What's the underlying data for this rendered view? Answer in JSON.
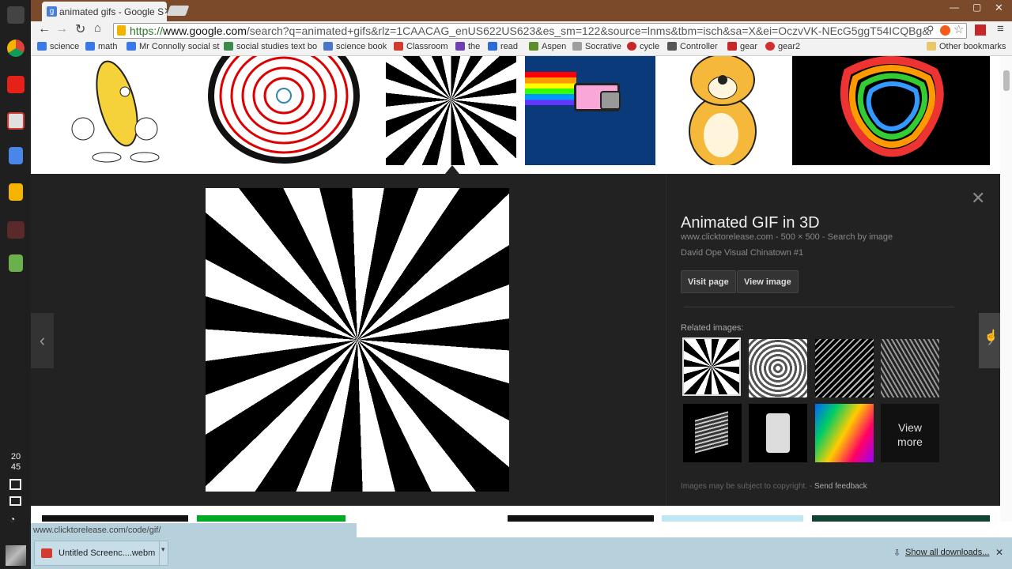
{
  "tab": {
    "title": "animated gifs - Google S"
  },
  "omnibox": {
    "url_scheme": "https://",
    "url_host": "www.google.com",
    "url_rest": "/search?q=animated+gifs&rlz=1CAACAG_enUS622US623&es_sm=122&source=lnms&tbm=isch&sa=X&ei=OczvVK-NEcG5ggT54ICQBg&"
  },
  "bookmarks": [
    {
      "label": "science",
      "color": "#3b78e7"
    },
    {
      "label": "math",
      "color": "#3b78e7"
    },
    {
      "label": "Mr Connolly social st",
      "color": "#3b78e7"
    },
    {
      "label": "social studies text bo",
      "color": "#3c8a4e"
    },
    {
      "label": "science book",
      "color": "#4a76c9"
    },
    {
      "label": "Classroom",
      "color": "#d23b2f"
    },
    {
      "label": "the",
      "color": "#6f3fb4"
    },
    {
      "label": "read",
      "color": "#2d6bd6"
    },
    {
      "label": "Aspen",
      "color": "#5c8f2a"
    },
    {
      "label": "Socrative",
      "color": "#9e9e9e"
    },
    {
      "label": "cycle",
      "color": "#c62828"
    },
    {
      "label": "Controller",
      "color": "#555555"
    },
    {
      "label": "gear",
      "color": "#c62828"
    },
    {
      "label": "gear2",
      "color": "#d32f2f"
    }
  ],
  "other_bookmarks": "Other bookmarks",
  "panel": {
    "title": "Animated GIF in 3D",
    "source": "www.clicktorelease.com",
    "dimensions": "500 × 500",
    "search_by_image": "Search by image",
    "description": "David Ope Visual Chinatown #1",
    "visit_page": "Visit page",
    "view_image": "View image",
    "related_label": "Related images:",
    "view_more": "View more",
    "copyright": "Images may be subject to copyright.",
    "send_feedback": "Send feedback"
  },
  "status_url": "www.clicktorelease.com/code/gif/",
  "download": {
    "filename": "Untitled Screenc....webm",
    "show_all": "Show all downloads..."
  },
  "clock": {
    "hour": "20",
    "minute": "45"
  }
}
